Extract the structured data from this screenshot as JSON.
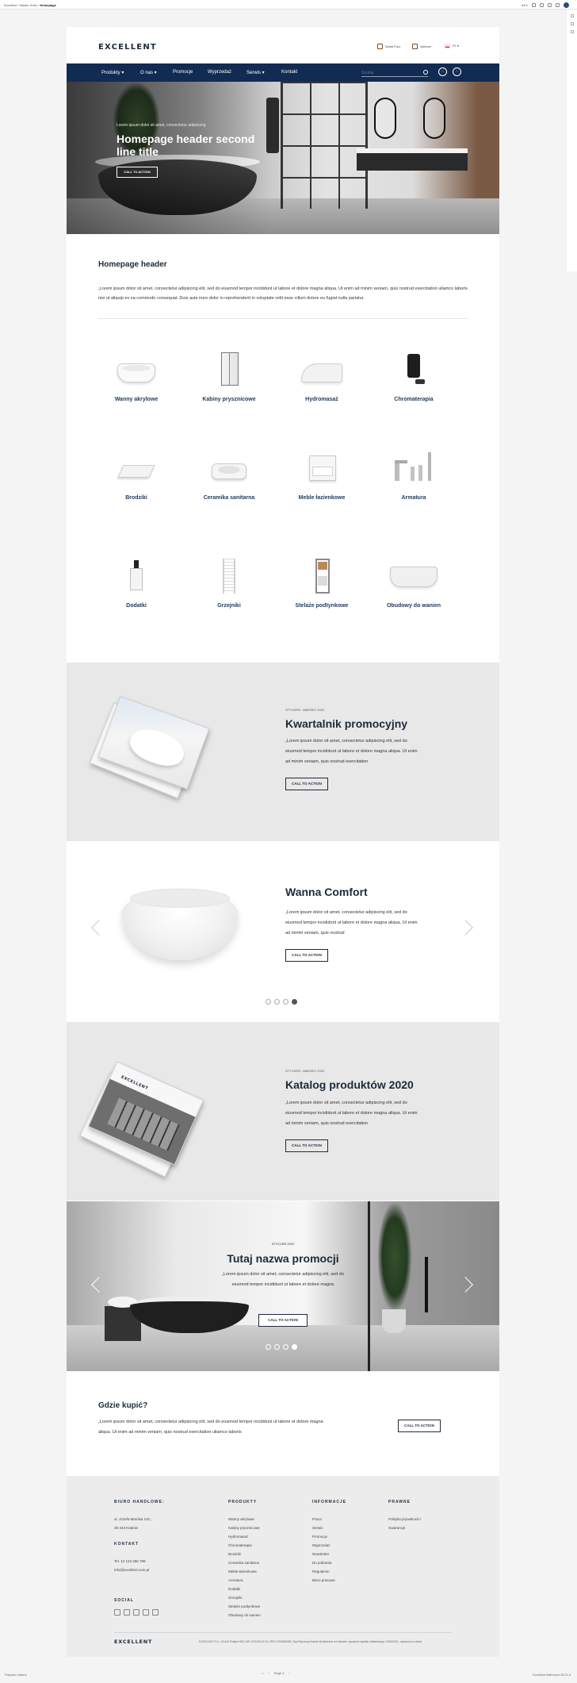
{
  "browser": {
    "breadcrumb_1": "Excellent",
    "breadcrumb_2": "Master Kreis",
    "breadcrumb_current": "Homepage",
    "zoom": "84%"
  },
  "header": {
    "logo": "EXCELLENT",
    "btn_1": "Szybki Pocz.",
    "btn_2": "Ulubione",
    "lang": "PL"
  },
  "nav": {
    "items": [
      "Produkty ▾",
      "O nas ▾",
      "Promocje",
      "Wyprzedaż",
      "Serwis ▾",
      "Kontakt"
    ],
    "search_placeholder": "Szukaj"
  },
  "hero": {
    "subtitle": "Lorem ipsum dolor sit amet, consectetur adipiscing",
    "title": "Homepage header second line title",
    "cta": "CALL TO ACTION"
  },
  "intro": {
    "title": "Homepage header",
    "text": "„Lorem ipsum dolor sit amet, consectetur adipiscing elit, sed do eiusmod tempor incididunt ut labore et dolore magna aliqua. Ut enim ad minim veniam, quis nostrud exercitation ullamco laboris nisi ut aliquip ex ea commodo consequat. Duis aute irure dolor in reprehenderit in voluptate velit esse cillum dolore eu fugiat nulla pariatur."
  },
  "categories": [
    {
      "label": "Wanny akrylowe",
      "icon": "bathtub-icon"
    },
    {
      "label": "Kabiny prysznicowe",
      "icon": "shower-cabin-icon"
    },
    {
      "label": "Hydromasaż",
      "icon": "hydromassage-icon"
    },
    {
      "label": "Chromaterapia",
      "icon": "chromatherapy-icon"
    },
    {
      "label": "Brodziki",
      "icon": "shower-tray-icon"
    },
    {
      "label": "Ceramika sanitarna",
      "icon": "washbasin-icon"
    },
    {
      "label": "Meble łazienkowe",
      "icon": "cabinet-icon"
    },
    {
      "label": "Armatura",
      "icon": "faucet-icon"
    },
    {
      "label": "Dodatki",
      "icon": "soap-dispenser-icon"
    },
    {
      "label": "Grzejniki",
      "icon": "radiator-icon"
    },
    {
      "label": "Stelaże podtynkowe",
      "icon": "frame-icon"
    },
    {
      "label": "Obudowy do wanien",
      "icon": "tub-panel-icon"
    }
  ],
  "promo1": {
    "eyebrow": "STYCZEŃ - MARZEC 2020",
    "title": "Kwartalnik promocyjny",
    "text": "„Lorem ipsum dolor sit amet, consectetur adipiscing elit, sed do eiusmod tempor incididunt ut labore et dolore magna aliqua. Ut enim ad minim veniam, quis nostrud exercitation",
    "cta": "CALL TO ACTION"
  },
  "product": {
    "title": "Wanna Comfort",
    "text": "„Lorem ipsum dolor sit amet, consectetur adipiscing elit, sed do eiusmod tempor incididunt ut labore et dolore magna aliqua. Ut enim ad minim veniam, quis nostrud",
    "cta": "CALL TO ACTION"
  },
  "catalog": {
    "eyebrow": "STYCZEŃ - MARZEC 2020",
    "title": "Katalog produktów 2020",
    "text": "„Lorem ipsum dolor sit amet, consectetur adipiscing elit, sed do eiusmod tempor incididunt ut labore et dolore magna aliqua. Ut enim ad minim veniam, quis nostrud exercitation",
    "cta": "CALL TO ACTION"
  },
  "promo2": {
    "eyebrow": "STYCZEŃ 2020",
    "title": "Tutaj nazwa promocji",
    "text": "„Lorem ipsum dolor sit amet, consectetur adipiscing elit, sed do eiusmod tempor incididunt ut labore et dolore magna",
    "cta": "CALL TO ACTION"
  },
  "where": {
    "title": "Gdzie kupić?",
    "text": "„Lorem ipsum dolor sit amet, consectetur adipiscing elit, sed do eiusmod tempor incididunt ut labore et dolore magna aliqua. Ut enim ad minim veniam, quis nostrud exercitation ullamco laboris",
    "cta": "CALL TO ACTION"
  },
  "footer": {
    "office_head": "BIURO HANDLOWE:",
    "office_lines": [
      "ul. Józefa Marcika 14C,",
      "30-443 Kraków"
    ],
    "contact_head": "KONTAKT",
    "contact_lines": [
      "Tel. 12 123 456 789",
      "info@excellent.com.pl"
    ],
    "social_head": "SOCIAL",
    "products_head": "PRODUKTY",
    "products": [
      "Wanny akrylowe",
      "Kabiny prysznicowe",
      "Hydromasaż",
      "Chromaterapia",
      "Brodziki",
      "Ceramika sanitarna",
      "Meble łazienkowe",
      "Armatura",
      "Dodatki",
      "Grzejniki",
      "Stelaże podtynkowe",
      "Obudowy do wanien"
    ],
    "info_head": "INFORMACJE",
    "info": [
      "Praca",
      "Serwis",
      "Promocje",
      "Wyprzedaż",
      "Newsletter",
      "Do pobrania",
      "Regulamin",
      "Biuro prasowe"
    ],
    "legal_head": "PRAWNE",
    "legal": [
      "Polityka prywatności",
      "Gwarancje"
    ],
    "logo": "EXCELLENT",
    "legal_text": "EXCELLENT S.A. | 30-443 Podłęże 652 | NIP: 675-000-57-51 | REG: 0000536499 | Sąd Rejonowy Kraków-Śródmieście w Krakowie, wysokość kapitału zakładowego: 100000000 - wpłacony w całości"
  },
  "bottom": {
    "left": "Prepare Intrans",
    "page": "Page 3",
    "right": "Excellent Bathroom ECG-3"
  }
}
